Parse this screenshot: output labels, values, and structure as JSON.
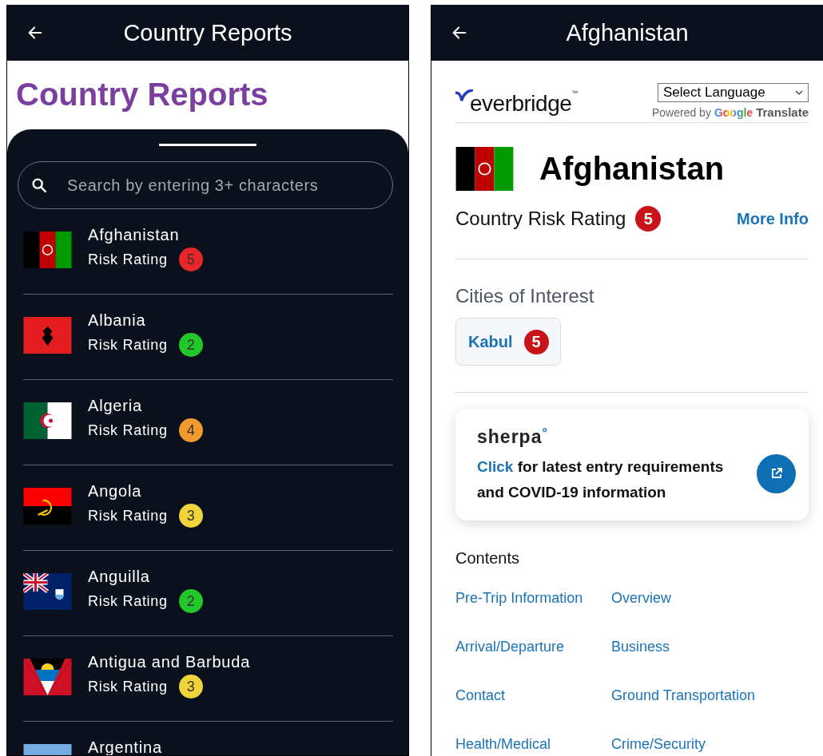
{
  "list_screen": {
    "header_title": "Country Reports",
    "page_title": "Country Reports",
    "search": {
      "placeholder": "Search by entering 3+ characters"
    },
    "countries": [
      {
        "name": "Afghanistan",
        "rating_label": "Risk Rating",
        "rating": "5",
        "color": "#e8262a"
      },
      {
        "name": "Albania",
        "rating_label": "Risk Rating",
        "rating": "2",
        "color": "#22c72a"
      },
      {
        "name": "Algeria",
        "rating_label": "Risk Rating",
        "rating": "4",
        "color": "#f39a2e"
      },
      {
        "name": "Angola",
        "rating_label": "Risk Rating",
        "rating": "3",
        "color": "#f0d43c"
      },
      {
        "name": "Anguilla",
        "rating_label": "Risk Rating",
        "rating": "2",
        "color": "#22c72a"
      },
      {
        "name": "Antigua and Barbuda",
        "rating_label": "Risk Rating",
        "rating": "3",
        "color": "#f0d43c"
      },
      {
        "name": "Argentina"
      }
    ]
  },
  "detail_screen": {
    "header_title": "Afghanistan",
    "logo": "everbridge",
    "logo_mark": "™",
    "language_select": "Select Language",
    "powered_by": "Powered by",
    "google": "Google",
    "translate": "Translate",
    "country": "Afghanistan",
    "risk_label": "Country Risk Rating",
    "risk_rating": "5",
    "more_info": "More Info",
    "cities_title": "Cities of Interest",
    "cities": [
      {
        "name": "Kabul",
        "rating": "5"
      }
    ],
    "sherpa": {
      "logo": "sherpa",
      "logo_mark": "°",
      "link": "Click",
      "text": "for latest entry requirements and **COVID-19** information"
    },
    "contents_title": "Contents",
    "contents": [
      "Pre-Trip Information",
      "Overview",
      "Arrival/Departure",
      "Business",
      "Contact",
      "Ground Transportation",
      "Health/Medical",
      "Crime/Security"
    ]
  }
}
